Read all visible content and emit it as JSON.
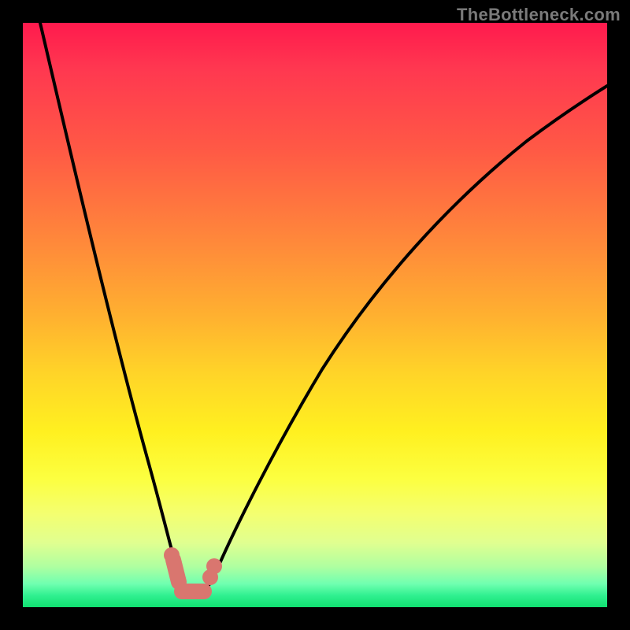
{
  "watermark": "TheBottleneck.com",
  "chart_data": {
    "type": "line",
    "title": "",
    "xlabel": "",
    "ylabel": "",
    "xlim": [
      0,
      100
    ],
    "ylim": [
      0,
      100
    ],
    "grid": false,
    "series": [
      {
        "name": "bottleneck-curve",
        "x": [
          3,
          5,
          8,
          12,
          16,
          20,
          23,
          25,
          27,
          29,
          31,
          33,
          36,
          40,
          46,
          54,
          64,
          76,
          90,
          100
        ],
        "y": [
          100,
          88,
          72,
          54,
          36,
          20,
          10,
          4,
          2,
          2,
          4,
          10,
          20,
          33,
          48,
          60,
          71,
          80,
          87,
          91
        ]
      }
    ],
    "markers": [
      {
        "name": "left-arm-top",
        "x": 25.3,
        "y": 9.0
      },
      {
        "name": "left-arm-bottom",
        "x": 26.3,
        "y": 4.5
      },
      {
        "name": "trough-segment",
        "x_from": 27.5,
        "x_to": 31.0,
        "y_from": 2.2,
        "y_to": 3.8
      },
      {
        "name": "right-arm",
        "x": 32.3,
        "y": 8.0
      }
    ],
    "background_gradient": {
      "top": "#ff1a4d",
      "upper_mid": "#ff8a3a",
      "mid": "#ffd428",
      "lower_mid": "#fcff40",
      "bottom": "#10e070"
    }
  }
}
